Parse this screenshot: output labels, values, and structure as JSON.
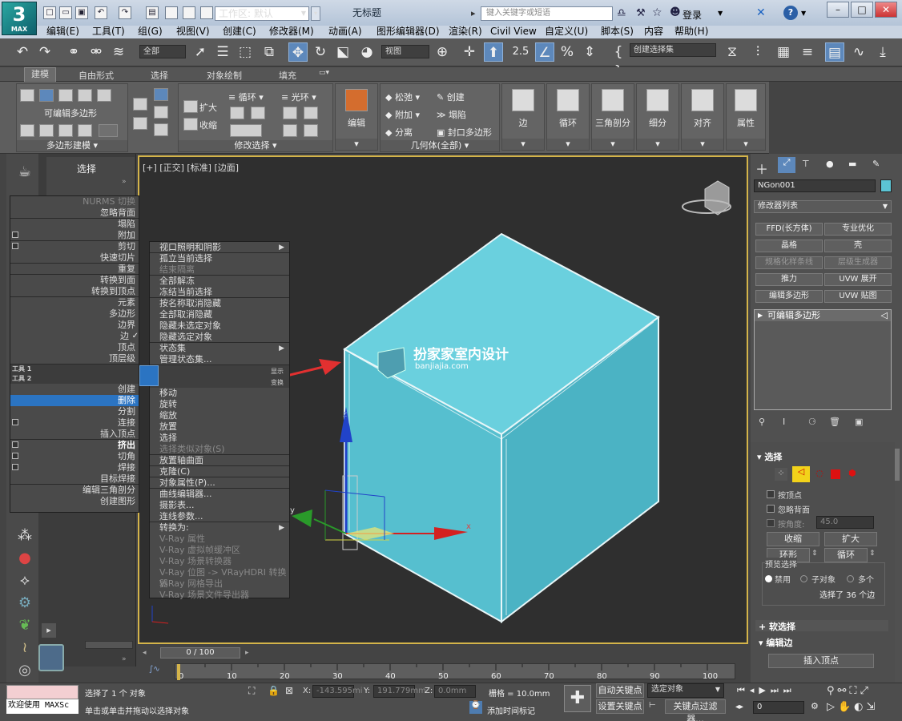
{
  "app": {
    "logo_text": "3",
    "logo_sub": "MAX",
    "doc_title": "无标题"
  },
  "quickaccess": {
    "workspace_label": "工作区: 默认",
    "search_placeholder": "键入关键字或短语",
    "login": "登录"
  },
  "menubar": [
    "编辑(E)",
    "工具(T)",
    "组(G)",
    "视图(V)",
    "创建(C)",
    "修改器(M)",
    "动画(A)",
    "图形编辑器(D)",
    "渲染(R)",
    "Civil View",
    "自定义(U)",
    "脚本(S)",
    "内容",
    "帮助(H)"
  ],
  "toolbar": {
    "filter_combo": "全部",
    "view_combo": "视图",
    "selection_set": "创建选择集",
    "snap_number": "2.5"
  },
  "ribbon": {
    "tabs": [
      "建模",
      "自由形式",
      "选择",
      "对象绘制",
      "填充"
    ],
    "active_tab": "建模",
    "poly_label": "可编辑多边形",
    "panel_polymodel": "多边形建模",
    "grow": "扩大",
    "shrink": "收缩",
    "loop": "循环",
    "ring": "光环",
    "panel_modsel": "修改选择",
    "edit": "编辑",
    "relax": "松弛",
    "create": "创建",
    "attach": "附加",
    "collapse": "塌陷",
    "detach": "分离",
    "cap_poly": "封口多边形",
    "panel_geometry": "几何体(全部)",
    "edges": "边",
    "loops": "循环",
    "tris": "三角剖分",
    "subdivide": "细分",
    "align": "对齐",
    "props": "属性"
  },
  "viewport": {
    "label": "[+] [正交] [标准] [边面]",
    "watermark_cn": "扮家家室内设计",
    "watermark_url": "banjiajia.com"
  },
  "graphite": {
    "header": "选择"
  },
  "quad_left": [
    {
      "label": "NURMS 切换",
      "kind": "dim"
    },
    {
      "label": "忽略背面",
      "kind": "sep"
    },
    {
      "label": "塌陷",
      "kind": ""
    },
    {
      "label": "附加",
      "kind": "chk sep"
    },
    {
      "label": "剪切",
      "kind": "chk"
    },
    {
      "label": "快速切片",
      "kind": "sep"
    },
    {
      "label": "重复",
      "kind": "sep"
    },
    {
      "label": "转换到面",
      "kind": ""
    },
    {
      "label": "转换到顶点",
      "kind": "sep"
    },
    {
      "label": "元素",
      "kind": ""
    },
    {
      "label": "多边形",
      "kind": ""
    },
    {
      "label": "边界",
      "kind": ""
    },
    {
      "label": "边",
      "kind": "tick"
    },
    {
      "label": "顶点",
      "kind": ""
    },
    {
      "label": "顶层级",
      "kind": "sep"
    },
    {
      "label": "工具 1",
      "kind": "ghead"
    },
    {
      "label": "工具 2",
      "kind": "ghead"
    },
    {
      "label": "创建",
      "kind": ""
    },
    {
      "label": "删除",
      "kind": "hl"
    },
    {
      "label": "分割",
      "kind": ""
    },
    {
      "label": "连接",
      "kind": "chk"
    },
    {
      "label": "插入顶点",
      "kind": "sep"
    },
    {
      "label": "挤出",
      "kind": "chk bold"
    },
    {
      "label": "切角",
      "kind": "chk"
    },
    {
      "label": "焊接",
      "kind": "chk"
    },
    {
      "label": "目标焊接",
      "kind": "sep"
    },
    {
      "label": "编辑三角剖分",
      "kind": ""
    },
    {
      "label": "创建图形",
      "kind": ""
    }
  ],
  "quad_right": [
    {
      "label": "视口照明和阴影",
      "kind": "arr sep"
    },
    {
      "label": "孤立当前选择",
      "kind": ""
    },
    {
      "label": "结束隔离",
      "kind": "dim sep"
    },
    {
      "label": "全部解冻",
      "kind": ""
    },
    {
      "label": "冻结当前选择",
      "kind": "sep"
    },
    {
      "label": "按名称取消隐藏",
      "kind": ""
    },
    {
      "label": "全部取消隐藏",
      "kind": ""
    },
    {
      "label": "隐藏未选定对象",
      "kind": ""
    },
    {
      "label": "隐藏选定对象",
      "kind": "sep"
    },
    {
      "label": "状态集",
      "kind": "arr"
    },
    {
      "label": "管理状态集...",
      "kind": "sep"
    },
    {
      "label": "",
      "kind": "blank"
    },
    {
      "label": "",
      "kind": "blank"
    },
    {
      "label": "移动",
      "kind": ""
    },
    {
      "label": "旋转",
      "kind": ""
    },
    {
      "label": "缩放",
      "kind": ""
    },
    {
      "label": "放置",
      "kind": ""
    },
    {
      "label": "选择",
      "kind": ""
    },
    {
      "label": "选择类似对象(S)",
      "kind": "dim sep"
    },
    {
      "label": "放置轴曲面",
      "kind": "sep"
    },
    {
      "label": "克隆(C)",
      "kind": "sep"
    },
    {
      "label": "对象属性(P)...",
      "kind": "sep"
    },
    {
      "label": "曲线编辑器...",
      "kind": ""
    },
    {
      "label": "摄影表...",
      "kind": ""
    },
    {
      "label": "连线参数...",
      "kind": "sep"
    },
    {
      "label": "转换为:",
      "kind": "arr"
    },
    {
      "label": "V-Ray 属性",
      "kind": "dim"
    },
    {
      "label": "V-Ray 虚拟帧缓冲区",
      "kind": "dim"
    },
    {
      "label": "V-Ray 场景转换器",
      "kind": "dim"
    },
    {
      "label": "V-Ray 位图 -> VRayHDRI 转换器",
      "kind": "dim"
    },
    {
      "label": "V-Ray 网格导出",
      "kind": "dim"
    },
    {
      "label": "V-Ray 场景文件导出器",
      "kind": "dim"
    }
  ],
  "cmdpanel": {
    "object_name": "NGon001",
    "modifier_list": "修改器列表",
    "mod_buttons": [
      {
        "label": "FFD(长方体)",
        "dim": false
      },
      {
        "label": "专业优化",
        "dim": false
      },
      {
        "label": "晶格",
        "dim": false
      },
      {
        "label": "壳",
        "dim": false
      },
      {
        "label": "规格化样条线",
        "dim": true
      },
      {
        "label": "层级生成器",
        "dim": true
      },
      {
        "label": "推力",
        "dim": false
      },
      {
        "label": "UVW 展开",
        "dim": false
      },
      {
        "label": "编辑多边形",
        "dim": false
      },
      {
        "label": "UVW 贴图",
        "dim": false
      }
    ],
    "stack_item": "可编辑多边形",
    "rollout_selection": "选择",
    "by_vertex": "按顶点",
    "ignore_backfacing": "忽略背面",
    "by_angle": "按角度:",
    "angle_value": "45.0",
    "shrink": "收缩",
    "grow": "扩大",
    "ring": "环形",
    "loop": "循环",
    "preview_selection": "预览选择",
    "preview_options": [
      "禁用",
      "子对象",
      "多个"
    ],
    "selected_info": "选择了 36 个边",
    "soft_selection": "软选择",
    "edit_edges": "编辑边",
    "insert_vertex": "插入顶点"
  },
  "timeline": {
    "frame_display": "0 / 100",
    "ticks": [
      "0",
      "10",
      "20",
      "30",
      "40",
      "50",
      "60",
      "70",
      "80",
      "90",
      "100"
    ]
  },
  "status": {
    "maxscript": "欢迎使用 MAXSc",
    "selected": "选择了 1 个 对象",
    "prompt": "单击或单击并拖动以选择对象",
    "x_label": "X:",
    "x_value": "-143.595mi",
    "y_label": "Y:",
    "y_value": "191.779mm",
    "z_label": "Z:",
    "z_value": "0.0mm",
    "grid": "栅格 = 10.0mm",
    "add_time_tag": "添加时间标记",
    "auto_key": "自动关键点",
    "selected_obj": "选定对象",
    "set_key": "设置关键点",
    "key_filters": "关键点过滤器...",
    "frame_field": "0"
  },
  "colors": {
    "accent": "#2b74c2",
    "viewport_border": "#d4b44a",
    "cube": "#5cc4d4",
    "arrow": "#e23030"
  }
}
